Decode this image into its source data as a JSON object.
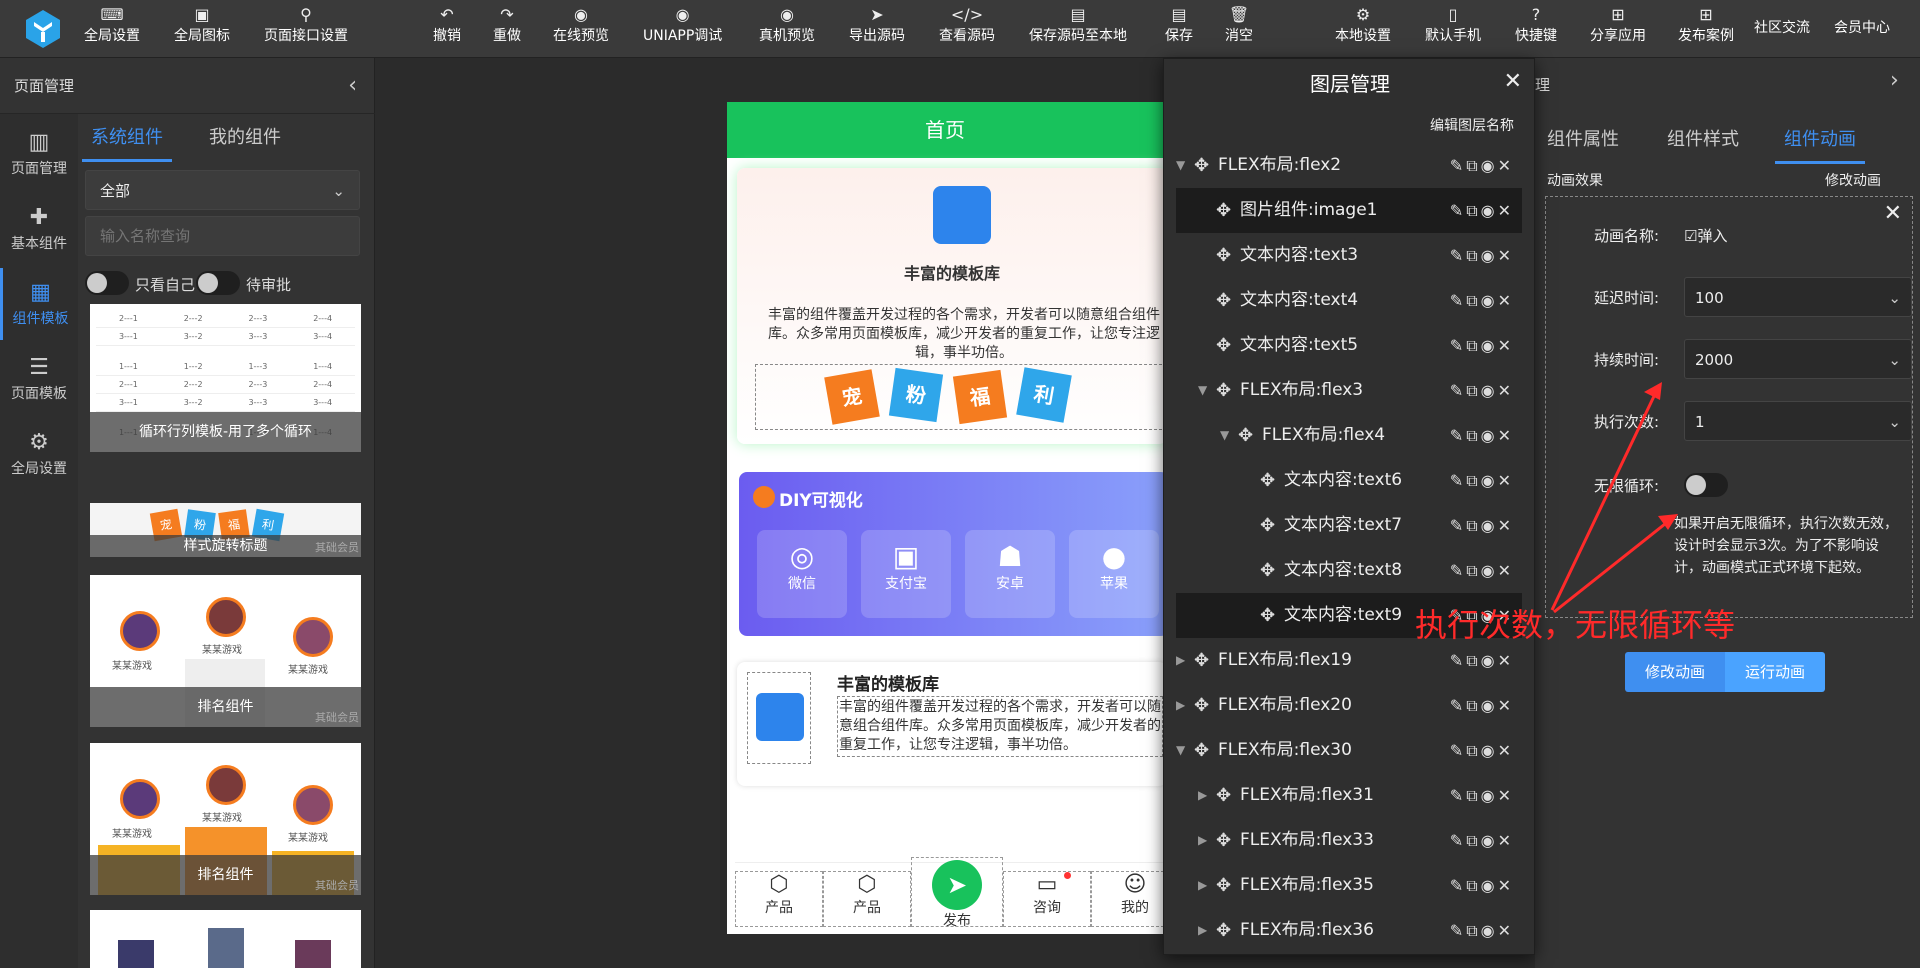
{
  "toolbar": {
    "left": [
      {
        "label": "全局设置",
        "icon": "gear-code-icon"
      },
      {
        "label": "全局图标",
        "icon": "icon-grid-icon"
      },
      {
        "label": "页面接口设置",
        "icon": "plug-icon"
      }
    ],
    "center": [
      {
        "label": "撤销",
        "icon": "undo-icon"
      },
      {
        "label": "重做",
        "icon": "redo-icon"
      },
      {
        "label": "在线预览",
        "icon": "eye-icon"
      },
      {
        "label": "UNIAPP调试",
        "icon": "eye-icon"
      },
      {
        "label": "真机预览",
        "icon": "eye-icon"
      },
      {
        "label": "导出源码",
        "icon": "send-icon"
      },
      {
        "label": "查看源码",
        "icon": "code-icon"
      },
      {
        "label": "保存源码至本地",
        "icon": "save-icon"
      },
      {
        "label": "保存",
        "icon": "save-icon"
      },
      {
        "label": "消空",
        "icon": "trash-icon"
      }
    ],
    "right": [
      {
        "label": "本地设置",
        "icon": "gear-icon"
      },
      {
        "label": "默认手机",
        "icon": "phone-icon"
      },
      {
        "label": "快捷键",
        "icon": "help-icon"
      },
      {
        "label": "分享应用",
        "icon": "share-icon"
      },
      {
        "label": "发布案例",
        "icon": "publish-icon"
      },
      {
        "label": "社区交流",
        "icon": ""
      },
      {
        "label": "会员中心",
        "icon": ""
      }
    ]
  },
  "left_panel": {
    "title": "页面管理",
    "nav": [
      {
        "label": "页面管理",
        "icon": "layout-icon"
      },
      {
        "label": "基本组件",
        "icon": "puzzle-icon"
      },
      {
        "label": "组件模板",
        "icon": "template-icon"
      },
      {
        "label": "页面模板",
        "icon": "database-icon"
      },
      {
        "label": "全局设置",
        "icon": "gear-icon"
      }
    ],
    "tabs": [
      "系统组件",
      "我的组件"
    ],
    "filter_select": "全部",
    "search_placeholder": "输入名称查询",
    "toggle_own": "只看自己",
    "toggle_review": "待审批",
    "cards": [
      {
        "caption": "循环行列模板-用了多个循环"
      },
      {
        "caption": "样式旋转标题",
        "tag": "其础会员"
      },
      {
        "caption": "排名组件",
        "tag": "其础会员"
      },
      {
        "caption": "排名组件",
        "tag": "其础会员"
      }
    ],
    "table_cells": [
      [
        "1---1",
        "1---2",
        "1---3",
        "1---4"
      ],
      [
        "2---1",
        "2---2",
        "2---3",
        "2---4"
      ],
      [
        "3---1",
        "3---2",
        "3---3",
        "3---4"
      ]
    ],
    "rank_names": [
      "某某游戏",
      "某某游戏",
      "某某游戏"
    ],
    "chips": [
      "宠",
      "粉",
      "福",
      "利"
    ]
  },
  "phone": {
    "title": "首页",
    "card1_title": "丰富的模板库",
    "card1_desc": "丰富的组件覆盖开发过程的各个需求，开发者可以随意组合组件库。众多常用页面模板库，减少开发者的重复工作，让您专注逻辑，事半功倍。",
    "chips": [
      "宠",
      "粉",
      "福",
      "利"
    ],
    "diy_title": "DIY可视化",
    "diy_items": [
      {
        "label": "微信",
        "icon": "wechat-icon"
      },
      {
        "label": "支付宝",
        "icon": "alipay-icon"
      },
      {
        "label": "安卓",
        "icon": "android-icon"
      },
      {
        "label": "苹果",
        "icon": "apple-icon"
      }
    ],
    "card3_title": "丰富的模板库",
    "card3_desc": "丰富的组件覆盖开发过程的各个需求，开发者可以随意组合组件库。众多常用页面模板库，减少开发者的重复工作，让您专注逻辑，事半功倍。",
    "tabbar": [
      {
        "label": "产品",
        "icon": "box-icon"
      },
      {
        "label": "产品",
        "icon": "box-icon"
      },
      {
        "label": "发布",
        "icon": "send-icon"
      },
      {
        "label": "咨询",
        "icon": "chat-icon"
      },
      {
        "label": "我的",
        "icon": "smile-icon"
      }
    ]
  },
  "layer_panel": {
    "title": "图层管理",
    "edit_label": "编辑图层名称",
    "rows": [
      {
        "name": "FLEX布局:flex2",
        "depth": 0,
        "arrow": "down"
      },
      {
        "name": "图片组件:image1",
        "depth": 1,
        "arrow": "",
        "selected": true
      },
      {
        "name": "文本内容:text3",
        "depth": 1,
        "arrow": ""
      },
      {
        "name": "文本内容:text4",
        "depth": 1,
        "arrow": ""
      },
      {
        "name": "文本内容:text5",
        "depth": 1,
        "arrow": ""
      },
      {
        "name": "FLEX布局:flex3",
        "depth": 1,
        "arrow": "down"
      },
      {
        "name": "FLEX布局:flex4",
        "depth": 2,
        "arrow": "down"
      },
      {
        "name": "文本内容:text6",
        "depth": 3,
        "arrow": ""
      },
      {
        "name": "文本内容:text7",
        "depth": 3,
        "arrow": ""
      },
      {
        "name": "文本内容:text8",
        "depth": 3,
        "arrow": ""
      },
      {
        "name": "文本内容:text9",
        "depth": 3,
        "arrow": "",
        "selected": true
      },
      {
        "name": "FLEX布局:flex19",
        "depth": 0,
        "arrow": "right"
      },
      {
        "name": "FLEX布局:flex20",
        "depth": 0,
        "arrow": "right"
      },
      {
        "name": "FLEX布局:flex30",
        "depth": 0,
        "arrow": "down"
      },
      {
        "name": "FLEX布局:flex31",
        "depth": 1,
        "arrow": "right"
      },
      {
        "name": "FLEX布局:flex33",
        "depth": 1,
        "arrow": "right"
      },
      {
        "name": "FLEX布局:flex35",
        "depth": 1,
        "arrow": "right"
      },
      {
        "name": "FLEX布局:flex36",
        "depth": 1,
        "arrow": "right"
      }
    ]
  },
  "right_panel": {
    "title_fragment": "理",
    "tabs": [
      "组件属性",
      "组件样式",
      "组件动画"
    ],
    "section_left": "动画效果",
    "section_right": "修改动画",
    "anim_name_label": "动画名称:",
    "anim_name_value": "弹入",
    "delay_label": "延迟时间:",
    "delay_value": "100",
    "duration_label": "持续时间:",
    "duration_value": "2000",
    "count_label": "执行次数:",
    "count_value": "1",
    "loop_label": "无限循环:",
    "loop_note": "如果开启无限循环，执行次数无效，设计时会显示3次。为了不影响设计，动画模式正式环境下起效。",
    "btn_modify": "修改动画",
    "btn_run": "运行动画"
  },
  "annotation": "执行次数，无限循环等",
  "colors": {
    "accent": "#3f8ff0",
    "brand_green": "#18c25c",
    "annotation_red": "#ff2a2a"
  }
}
